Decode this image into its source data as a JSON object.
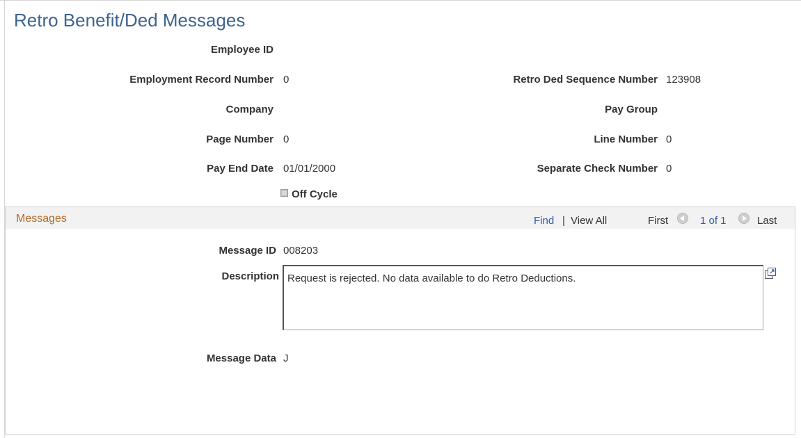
{
  "page": {
    "title": "Retro Benefit/Ded Messages"
  },
  "header_fields": {
    "employee_id": {
      "label": "Employee ID",
      "value": ""
    },
    "employment_record_number": {
      "label": "Employment Record Number",
      "value": "0"
    },
    "retro_ded_sequence_number": {
      "label": "Retro Ded Sequence Number",
      "value": "123908"
    },
    "company": {
      "label": "Company",
      "value": ""
    },
    "pay_group": {
      "label": "Pay Group",
      "value": ""
    },
    "page_number": {
      "label": "Page Number",
      "value": "0"
    },
    "line_number": {
      "label": "Line Number",
      "value": "0"
    },
    "pay_end_date": {
      "label": "Pay End Date",
      "value": "01/01/2000"
    },
    "separate_check_number": {
      "label": "Separate Check Number",
      "value": "0"
    },
    "off_cycle": {
      "label": "Off Cycle",
      "checked": false
    }
  },
  "messages_grid": {
    "title": "Messages",
    "find_label": "Find",
    "separator": "|",
    "view_all_label": "View All",
    "first_label": "First",
    "position_text": "1 of 1",
    "last_label": "Last",
    "message_id": {
      "label": "Message ID",
      "value": "008203"
    },
    "description": {
      "label": "Description",
      "value": "Request is rejected.  No data available to do Retro Deductions."
    },
    "message_data": {
      "label": "Message Data",
      "value": "J"
    }
  },
  "colors": {
    "title": "#3d6490",
    "grid_title": "#b26a2b",
    "link": "#2a5db0"
  }
}
